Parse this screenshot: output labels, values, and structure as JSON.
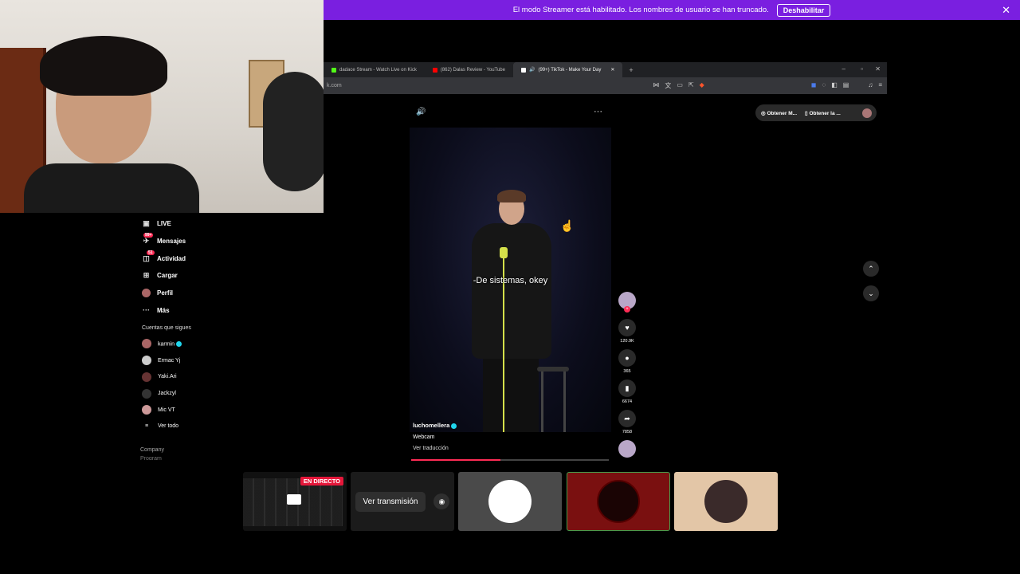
{
  "banner": {
    "text": "El modo Streamer está habilitado. Los nombres de usuario se han truncado.",
    "button": "Deshabilitar",
    "close": "✕",
    "color": "#7a1fe0"
  },
  "browser": {
    "tabs": [
      {
        "label": "dadace Stream - Watch Live on Kick",
        "icon": "kick-icon",
        "color": "#53fc18"
      },
      {
        "label": "(862) Dalas Review - YouTube",
        "icon": "youtube-icon",
        "color": "#ff0000"
      },
      {
        "label": "(99+) TikTok - Make Your Day",
        "icon": "tiktok-icon",
        "color": "#ffffff"
      }
    ],
    "active_tab_close": "✕",
    "new_tab": "+",
    "url": "k.com",
    "win_min": "–",
    "win_max": "▫",
    "win_close": "✕"
  },
  "sidebar": {
    "nav": [
      {
        "label": "LIVE",
        "icon": "live-icon",
        "glyph": "▣"
      },
      {
        "label": "Mensajes",
        "icon": "messages-icon",
        "glyph": "✈",
        "badge": "99+"
      },
      {
        "label": "Actividad",
        "icon": "activity-icon",
        "glyph": "◫",
        "badge": "51"
      },
      {
        "label": "Cargar",
        "icon": "upload-icon",
        "glyph": "⊞"
      },
      {
        "label": "Perfil",
        "icon": "profile-icon",
        "glyph": "●"
      },
      {
        "label": "Más",
        "icon": "more-icon",
        "glyph": "···"
      }
    ],
    "following_title": "Cuentas que sigues",
    "following": [
      {
        "name": "karmin",
        "verified": true
      },
      {
        "name": "Ermac Yj",
        "verified": false
      },
      {
        "name": "Yaki.Ari",
        "verified": false
      },
      {
        "name": "Jackzyl",
        "verified": false
      },
      {
        "name": "Mic VT",
        "verified": false
      }
    ],
    "see_all": "Ver todo",
    "footer": [
      "Company",
      "Program"
    ]
  },
  "video": {
    "subtitle": "-De sistemas, okey",
    "author": "luchomellera",
    "description": "Webcam",
    "translate": "Ver traducción",
    "progress": 0.45,
    "volume_icon": "🔊",
    "more_icon": "···"
  },
  "actions": {
    "likes": "120.9K",
    "comments": "365",
    "saves": "6674",
    "shares": "7858"
  },
  "top_right": {
    "get1": "Obtener M...",
    "get2": "Obtener la ..."
  },
  "nav_arrows": {
    "up": "⌃",
    "down": "⌄"
  },
  "bottom": {
    "live_badge": "EN DIRECTO",
    "watch_label": "Ver transmisión"
  }
}
